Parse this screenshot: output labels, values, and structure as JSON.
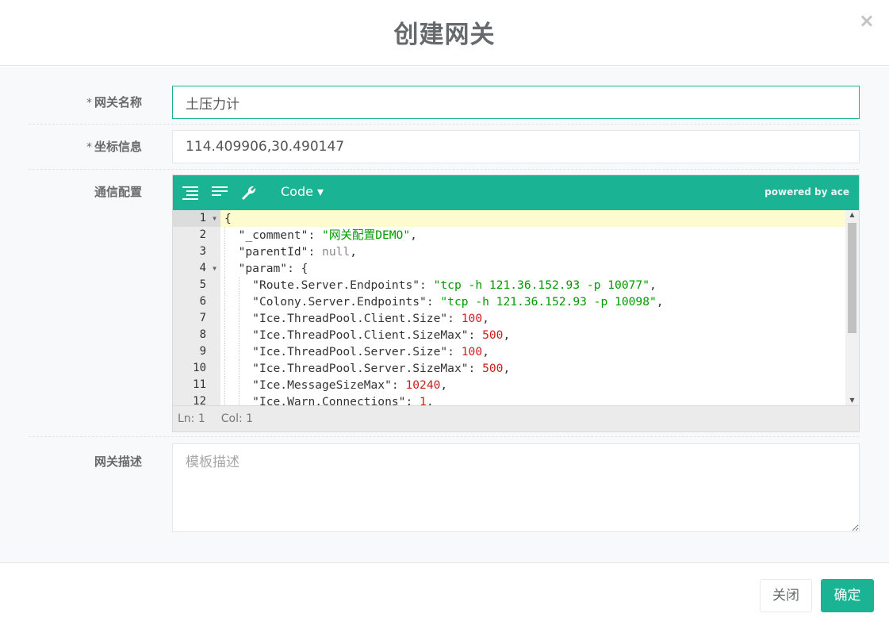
{
  "dialog": {
    "title": "创建网关",
    "close_symbol": "×"
  },
  "form": {
    "gateway_name": {
      "label": "网关名称",
      "required_mark": "*",
      "value": "土压力计"
    },
    "coordinates": {
      "label": "坐标信息",
      "required_mark": "*",
      "value": "114.409906,30.490147"
    },
    "comm_config": {
      "label": "通信配置"
    },
    "description": {
      "label": "网关描述",
      "placeholder": "模板描述",
      "value": ""
    }
  },
  "editor": {
    "mode_label": "Code ▾",
    "powered_by": "powered by ace",
    "status": {
      "ln": "Ln: 1",
      "col": "Col: 1"
    },
    "gutter": [
      "1",
      "2",
      "3",
      "4",
      "5",
      "6",
      "7",
      "8",
      "9",
      "10",
      "11",
      "12"
    ],
    "lines": [
      {
        "indent": 0,
        "tokens": [
          {
            "t": "{",
            "c": "k"
          }
        ]
      },
      {
        "indent": 1,
        "tokens": [
          {
            "t": "\"_comment\"",
            "c": "k"
          },
          {
            "t": ": ",
            "c": "k"
          },
          {
            "t": "\"网关配置DEMO\"",
            "c": "s"
          },
          {
            "t": ",",
            "c": "k"
          }
        ]
      },
      {
        "indent": 1,
        "tokens": [
          {
            "t": "\"parentId\"",
            "c": "k"
          },
          {
            "t": ": ",
            "c": "k"
          },
          {
            "t": "null",
            "c": "nl"
          },
          {
            "t": ",",
            "c": "k"
          }
        ]
      },
      {
        "indent": 1,
        "tokens": [
          {
            "t": "\"param\"",
            "c": "k"
          },
          {
            "t": ": {",
            "c": "k"
          }
        ]
      },
      {
        "indent": 2,
        "tokens": [
          {
            "t": "\"Route.Server.Endpoints\"",
            "c": "k"
          },
          {
            "t": ": ",
            "c": "k"
          },
          {
            "t": "\"tcp -h 121.36.152.93 -p 10077\"",
            "c": "s"
          },
          {
            "t": ",",
            "c": "k"
          }
        ]
      },
      {
        "indent": 2,
        "tokens": [
          {
            "t": "\"Colony.Server.Endpoints\"",
            "c": "k"
          },
          {
            "t": ": ",
            "c": "k"
          },
          {
            "t": "\"tcp -h 121.36.152.93 -p 10098\"",
            "c": "s"
          },
          {
            "t": ",",
            "c": "k"
          }
        ]
      },
      {
        "indent": 2,
        "tokens": [
          {
            "t": "\"Ice.ThreadPool.Client.Size\"",
            "c": "k"
          },
          {
            "t": ": ",
            "c": "k"
          },
          {
            "t": "100",
            "c": "n"
          },
          {
            "t": ",",
            "c": "k"
          }
        ]
      },
      {
        "indent": 2,
        "tokens": [
          {
            "t": "\"Ice.ThreadPool.Client.SizeMax\"",
            "c": "k"
          },
          {
            "t": ": ",
            "c": "k"
          },
          {
            "t": "500",
            "c": "n"
          },
          {
            "t": ",",
            "c": "k"
          }
        ]
      },
      {
        "indent": 2,
        "tokens": [
          {
            "t": "\"Ice.ThreadPool.Server.Size\"",
            "c": "k"
          },
          {
            "t": ": ",
            "c": "k"
          },
          {
            "t": "100",
            "c": "n"
          },
          {
            "t": ",",
            "c": "k"
          }
        ]
      },
      {
        "indent": 2,
        "tokens": [
          {
            "t": "\"Ice.ThreadPool.Server.SizeMax\"",
            "c": "k"
          },
          {
            "t": ": ",
            "c": "k"
          },
          {
            "t": "500",
            "c": "n"
          },
          {
            "t": ",",
            "c": "k"
          }
        ]
      },
      {
        "indent": 2,
        "tokens": [
          {
            "t": "\"Ice.MessageSizeMax\"",
            "c": "k"
          },
          {
            "t": ": ",
            "c": "k"
          },
          {
            "t": "10240",
            "c": "n"
          },
          {
            "t": ",",
            "c": "k"
          }
        ]
      },
      {
        "indent": 2,
        "tokens": [
          {
            "t": "\"Ice.Warn.Connections\"",
            "c": "k"
          },
          {
            "t": ": ",
            "c": "k"
          },
          {
            "t": "1",
            "c": "n"
          },
          {
            "t": ",",
            "c": "k"
          }
        ]
      }
    ]
  },
  "footer": {
    "close_label": "关闭",
    "confirm_label": "确定"
  },
  "colors": {
    "accent": "#1ab394",
    "active_line": "#fffbd1",
    "string": "#009900",
    "number": "#cd1d1d"
  },
  "icons": [
    "format-icon",
    "compact-icon",
    "repair-icon",
    "close-icon"
  ]
}
